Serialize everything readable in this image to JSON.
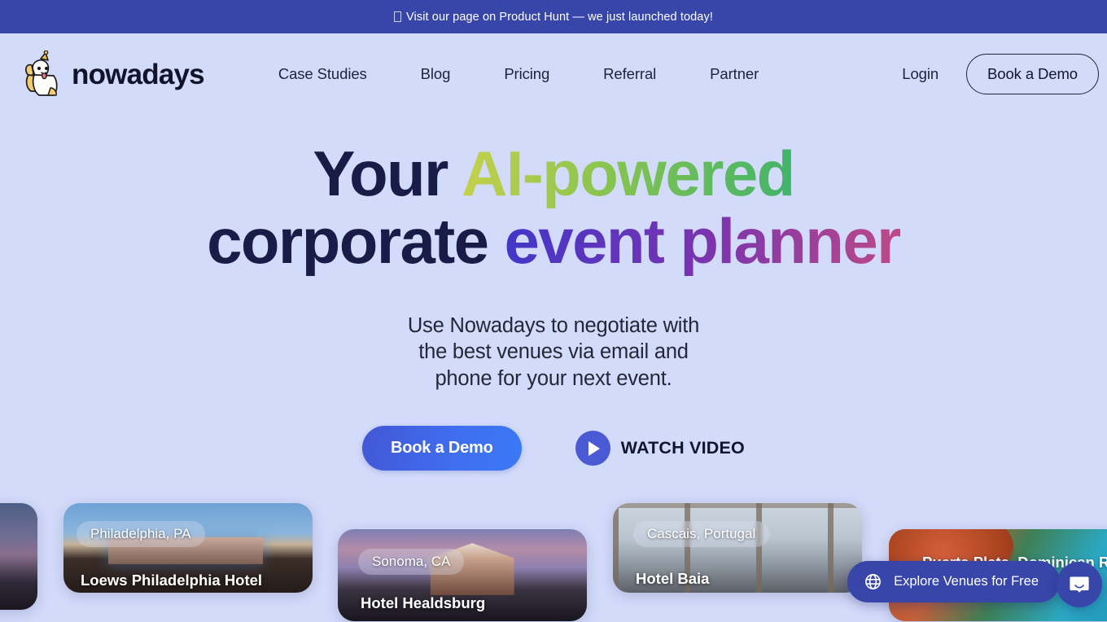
{
  "banner": {
    "icon": "missing-glyph-box",
    "text": "Visit our page on Product Hunt — we just launched today!",
    "background": "#3746a8"
  },
  "nav": {
    "brand": {
      "name": "nowadays",
      "logo_icon": "party-dog-logo"
    },
    "links": [
      {
        "label": "Case Studies"
      },
      {
        "label": "Blog"
      },
      {
        "label": "Pricing"
      },
      {
        "label": "Referral"
      },
      {
        "label": "Partner"
      }
    ],
    "login_label": "Login",
    "demo_label": "Book a Demo"
  },
  "hero": {
    "headline": {
      "line1_plain": "Your ",
      "line1_accent": "AI-powered",
      "line2_plain": "corporate ",
      "line2_accent": "event planner"
    },
    "subhead_line1": "Use Nowadays to negotiate with",
    "subhead_line2": "the best venues via email and",
    "subhead_line3": "phone for your next event.",
    "primary_cta": "Book a Demo",
    "watch_label": "WATCH VIDEO",
    "accent_green": "#86c44f",
    "accent_purple": "#7b34ae",
    "accent_blue": "#3f6ff0"
  },
  "venues": [
    {
      "location": "",
      "name": "",
      "photo": "ph-left",
      "partial": true
    },
    {
      "location": "Philadelphia, PA",
      "name": "Loews Philadelphia Hotel",
      "photo": "ph-loews"
    },
    {
      "location": "Sonoma, CA",
      "name": "Hotel Healdsburg",
      "photo": "ph-healdsburg"
    },
    {
      "location": "Cascais, Portugal",
      "name": "Hotel Baia",
      "photo": "ph-baia"
    },
    {
      "location": "Puerta Plata, Dominican Republic",
      "name": "",
      "photo": "ph-puerta"
    }
  ],
  "widgets": {
    "explore_label": "Explore Venues for Free",
    "explore_icon": "globe-icon",
    "chat_icon": "chat-bubble-icon",
    "widget_color": "#3746a8"
  }
}
